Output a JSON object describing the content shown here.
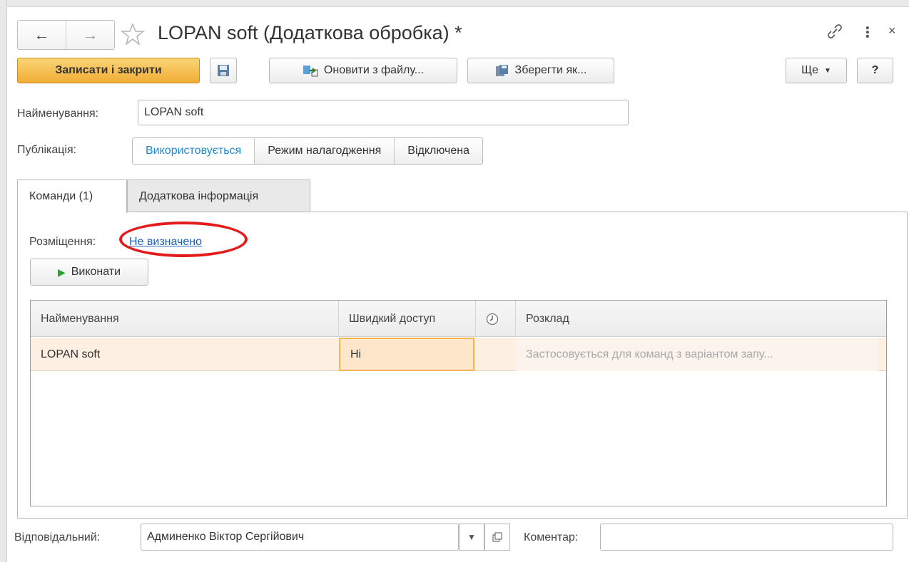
{
  "window": {
    "title": "LOPAN soft (Додаткова обробка) *"
  },
  "toolbar": {
    "save_close": "Записати і закрити",
    "update_from_file": "Оновити з файлу...",
    "save_as": "Зберегти як...",
    "more": "Ще",
    "help": "?"
  },
  "form": {
    "name_label": "Найменування:",
    "name_value": "LOPAN soft",
    "publication_label": "Публікація:",
    "publication_options": [
      "Використовується",
      "Режим налагодження",
      "Відключена"
    ],
    "publication_selected": "Використовується"
  },
  "tabs": [
    {
      "label": "Команди (1)",
      "active": true
    },
    {
      "label": "Додаткова інформація",
      "active": false
    }
  ],
  "commands": {
    "placement_label": "Розміщення:",
    "placement_value": "Не визначено",
    "run_button": "Виконати",
    "columns": [
      "Найменування",
      "Швидкий доступ",
      "clock-icon",
      "Розклад"
    ],
    "rows": [
      {
        "name": "LOPAN soft",
        "quick_access": "Ні",
        "schedule": "Застосовується для команд з варіантом запу..."
      }
    ]
  },
  "footer": {
    "responsible_label": "Відповідальний:",
    "responsible_value": "Админенко Віктор Сергійович",
    "comment_label": "Коментар:",
    "comment_value": ""
  },
  "colors": {
    "primary_button": "#f1ae35",
    "link": "#1d5eb8",
    "selected_segment": "#1c8bd2",
    "highlight_row": "#fdefe2",
    "annotation": "#e41b1b"
  }
}
